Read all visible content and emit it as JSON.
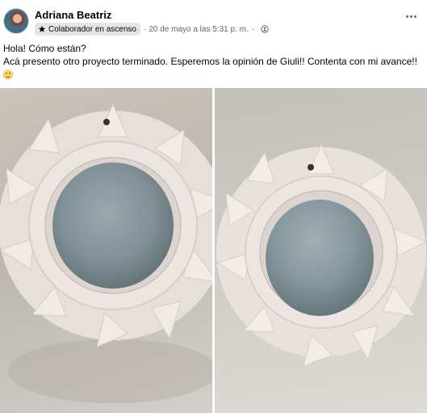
{
  "post": {
    "author": "Adriana Beatriz",
    "badge": "Colaborador en ascenso",
    "separator": "·",
    "timestamp": "20 de mayo a las 5:31 p. m.",
    "privacy_icon": "group-icon",
    "text_line1": "Hola! Cómo están?",
    "text_line2": "Acá presento otro proyecto terminado. Esperemos la opinión de Giuli!! Contenta con mi avance!!",
    "emoji": "smiling-face-emoji"
  },
  "photos": [
    {
      "subject": "macrame round mirror, front view"
    },
    {
      "subject": "macrame round mirror, angled view"
    }
  ],
  "colors": {
    "name": "#050505",
    "meta": "#65676b",
    "badge_bg": "#e4e6eb",
    "macrame": "#ece5e2",
    "mirror": "#7c8e96"
  }
}
